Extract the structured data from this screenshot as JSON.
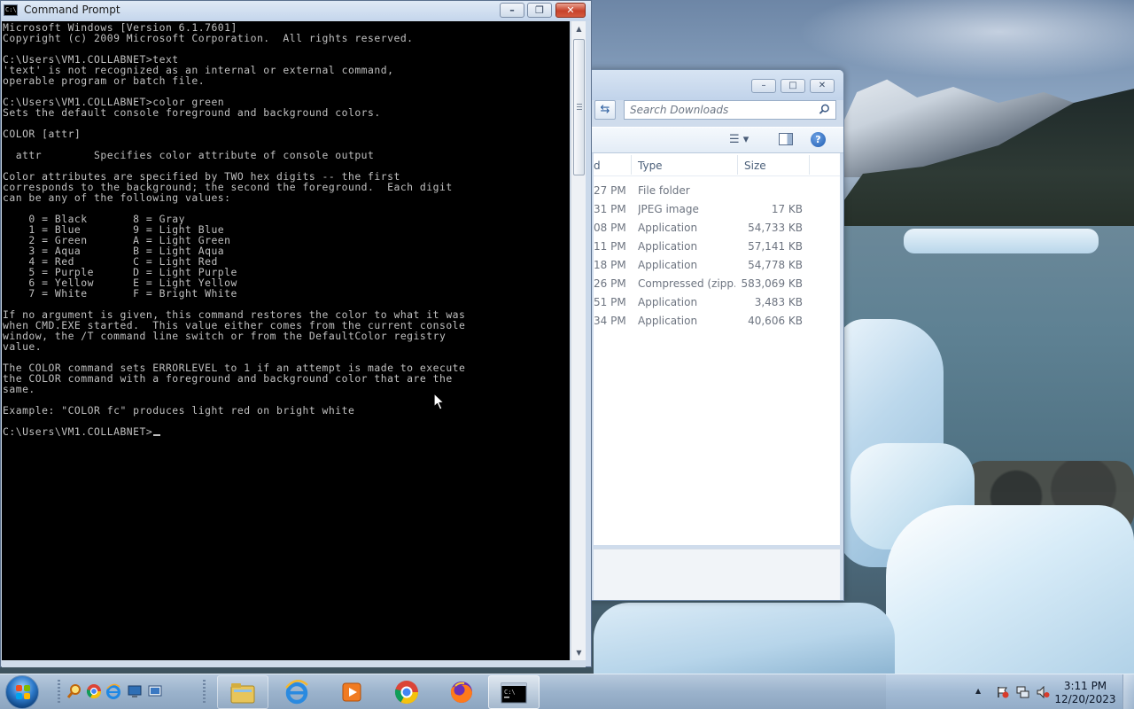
{
  "command_prompt": {
    "title": "Command Prompt",
    "icon_text": "C:\\",
    "lines": [
      "Microsoft Windows [Version 6.1.7601]",
      "Copyright (c) 2009 Microsoft Corporation.  All rights reserved.",
      "",
      "C:\\Users\\VM1.COLLABNET>text",
      "'text' is not recognized as an internal or external command,",
      "operable program or batch file.",
      "",
      "C:\\Users\\VM1.COLLABNET>color green",
      "Sets the default console foreground and background colors.",
      "",
      "COLOR [attr]",
      "",
      "  attr        Specifies color attribute of console output",
      "",
      "Color attributes are specified by TWO hex digits -- the first",
      "corresponds to the background; the second the foreground.  Each digit",
      "can be any of the following values:",
      "",
      "    0 = Black       8 = Gray",
      "    1 = Blue        9 = Light Blue",
      "    2 = Green       A = Light Green",
      "    3 = Aqua        B = Light Aqua",
      "    4 = Red         C = Light Red",
      "    5 = Purple      D = Light Purple",
      "    6 = Yellow      E = Light Yellow",
      "    7 = White       F = Bright White",
      "",
      "If no argument is given, this command restores the color to what it was",
      "when CMD.EXE started.  This value either comes from the current console",
      "window, the /T command line switch or from the DefaultColor registry",
      "value.",
      "",
      "The COLOR command sets ERRORLEVEL to 1 if an attempt is made to execute",
      "the COLOR command with a foreground and background color that are the",
      "same.",
      "",
      "Example: \"COLOR fc\" produces light red on bright white",
      ""
    ],
    "prompt": "C:\\Users\\VM1.COLLABNET>",
    "text_color": "#c0c0c0",
    "background_color": "#000000"
  },
  "explorer": {
    "search_placeholder": "Search Downloads",
    "columns": {
      "date_fragment": "d",
      "type": "Type",
      "size": "Size"
    },
    "rows": [
      {
        "time": "27 PM",
        "type": "File folder",
        "size": ""
      },
      {
        "time": "31 PM",
        "type": "JPEG image",
        "size": "17 KB"
      },
      {
        "time": "08 PM",
        "type": "Application",
        "size": "54,733 KB"
      },
      {
        "time": "11 PM",
        "type": "Application",
        "size": "57,141 KB"
      },
      {
        "time": "18 PM",
        "type": "Application",
        "size": "54,778 KB"
      },
      {
        "time": "26 PM",
        "type": "Compressed (zipp...",
        "size": "583,069 KB"
      },
      {
        "time": "51 PM",
        "type": "Application",
        "size": "3,483 KB"
      },
      {
        "time": "34 PM",
        "type": "Application",
        "size": "40,606 KB"
      }
    ]
  },
  "taskbar": {
    "quick_launch": [
      "search-icon",
      "chrome-icon",
      "internet-explorer-icon",
      "computer-icon",
      "network-icon"
    ],
    "apps": [
      "windows-explorer",
      "internet-explorer",
      "media-player",
      "google-chrome",
      "firefox",
      "command-prompt"
    ],
    "active_app": "command-prompt",
    "clock_time": "3:11 PM",
    "clock_date": "12/20/2023"
  }
}
